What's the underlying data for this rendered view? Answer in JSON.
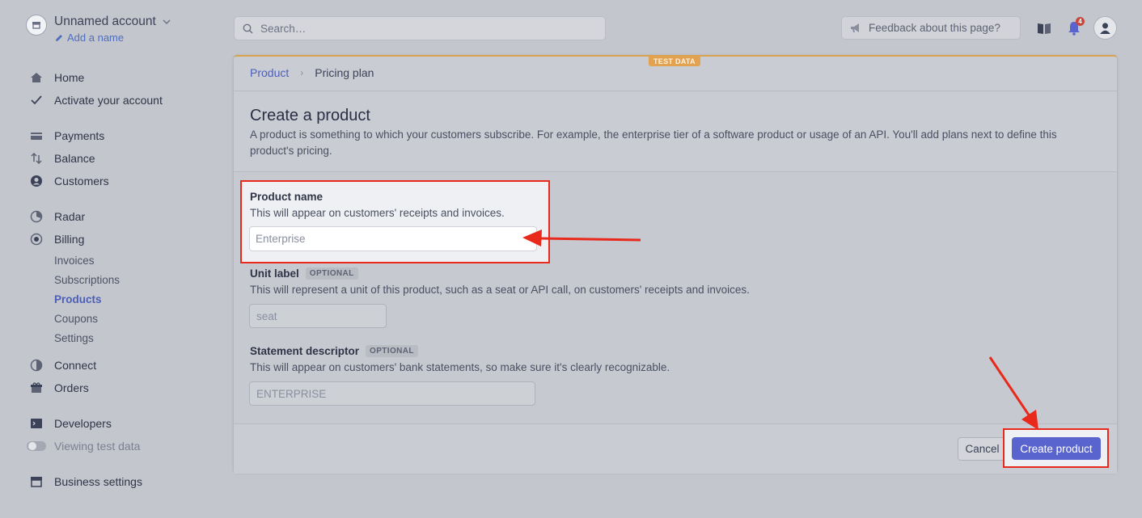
{
  "account": {
    "name": "Unnamed account",
    "add_name": "Add a name"
  },
  "nav": {
    "home": "Home",
    "activate": "Activate your account",
    "payments": "Payments",
    "balance": "Balance",
    "customers": "Customers",
    "radar": "Radar",
    "billing": "Billing",
    "billing_sub": [
      "Invoices",
      "Subscriptions",
      "Products",
      "Coupons",
      "Settings"
    ],
    "connect": "Connect",
    "orders": "Orders",
    "developers": "Developers",
    "viewing_test_data": "Viewing test data",
    "business_settings": "Business settings"
  },
  "topbar": {
    "search_placeholder": "Search…",
    "feedback": "Feedback about this page?",
    "notification_count": "4"
  },
  "page": {
    "test_badge": "TEST DATA",
    "breadcrumb": [
      "Product",
      "Pricing plan"
    ],
    "title": "Create a product",
    "description": "A product is something to which your customers subscribe. For example, the enterprise tier of a software product or usage of an API. You'll add plans next to define this product's pricing."
  },
  "form": {
    "product_name": {
      "label": "Product name",
      "help": "This will appear on customers' receipts and invoices.",
      "placeholder": "Enterprise"
    },
    "unit_label": {
      "label": "Unit label",
      "tag": "OPTIONAL",
      "help": "This will represent a unit of this product, such as a seat or API call, on customers' receipts and invoices.",
      "placeholder": "seat"
    },
    "statement_descriptor": {
      "label": "Statement descriptor",
      "tag": "OPTIONAL",
      "help": "This will appear on customers' bank statements, so make sure it's clearly recognizable.",
      "placeholder": "ENTERPRISE"
    }
  },
  "footer": {
    "cancel": "Cancel",
    "create": "Create product"
  },
  "colors": {
    "accent": "#5a64cf",
    "highlight": "#e8291c",
    "link": "#4c5fb8",
    "test_badge": "#e3a24f"
  }
}
